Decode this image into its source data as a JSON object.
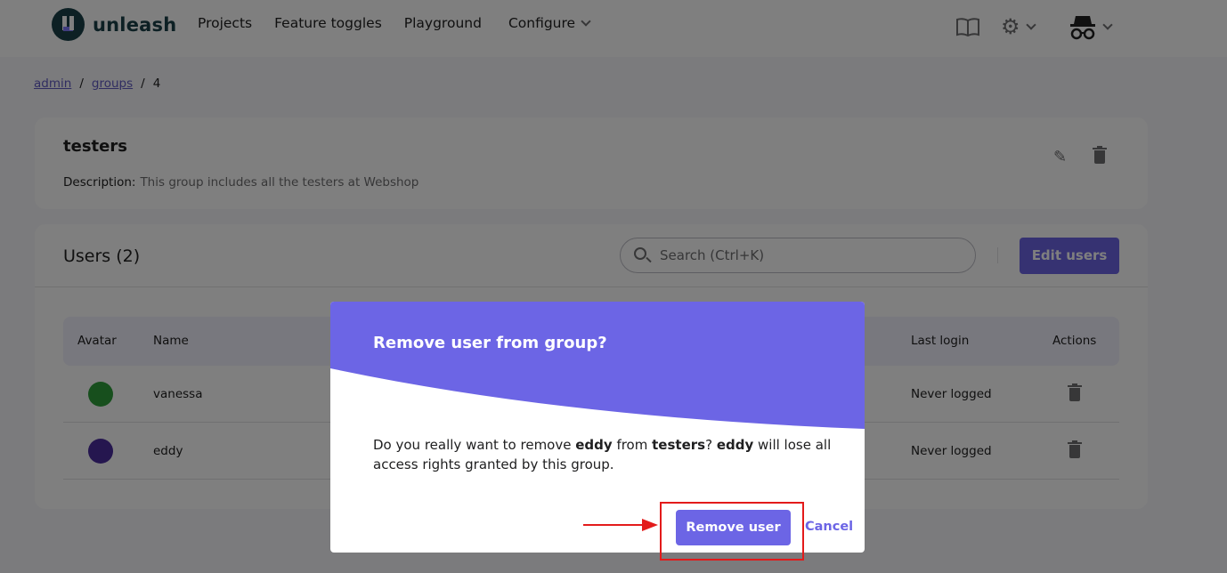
{
  "app": {
    "name": "unleash"
  },
  "nav": {
    "items": [
      "Projects",
      "Feature toggles",
      "Playground"
    ],
    "configure": "Configure"
  },
  "breadcrumb": {
    "admin": "admin",
    "groups": "groups",
    "current": "4"
  },
  "group": {
    "name": "testers",
    "description_label": "Description:",
    "description": "This group includes all the testers at Webshop"
  },
  "users": {
    "title": "Users (2)",
    "search_placeholder": "Search (Ctrl+K)",
    "edit_button": "Edit users",
    "columns": {
      "avatar": "Avatar",
      "name": "Name",
      "last_login": "Last login",
      "actions": "Actions"
    },
    "rows": [
      {
        "name": "vanessa",
        "last_login": "Never logged",
        "avatar_color": "#2e9e3a"
      },
      {
        "name": "eddy",
        "last_login": "Never logged",
        "avatar_color": "#4a2c9e"
      }
    ]
  },
  "dialog": {
    "title": "Remove user from group?",
    "text_1": "Do you really want to remove ",
    "user": "eddy",
    "text_2": " from ",
    "group": "testers",
    "text_3": "? ",
    "user2": "eddy",
    "text_4": " will lose all access rights granted by this group.",
    "confirm": "Remove user",
    "cancel": "Cancel"
  },
  "colors": {
    "primary": "#6c65e5",
    "highlight": "#e31b1b",
    "logo": "#1a4049"
  },
  "icons": [
    "book-icon",
    "gear-icon",
    "user-incognito-icon",
    "pencil-icon",
    "trash-icon",
    "search-icon"
  ]
}
